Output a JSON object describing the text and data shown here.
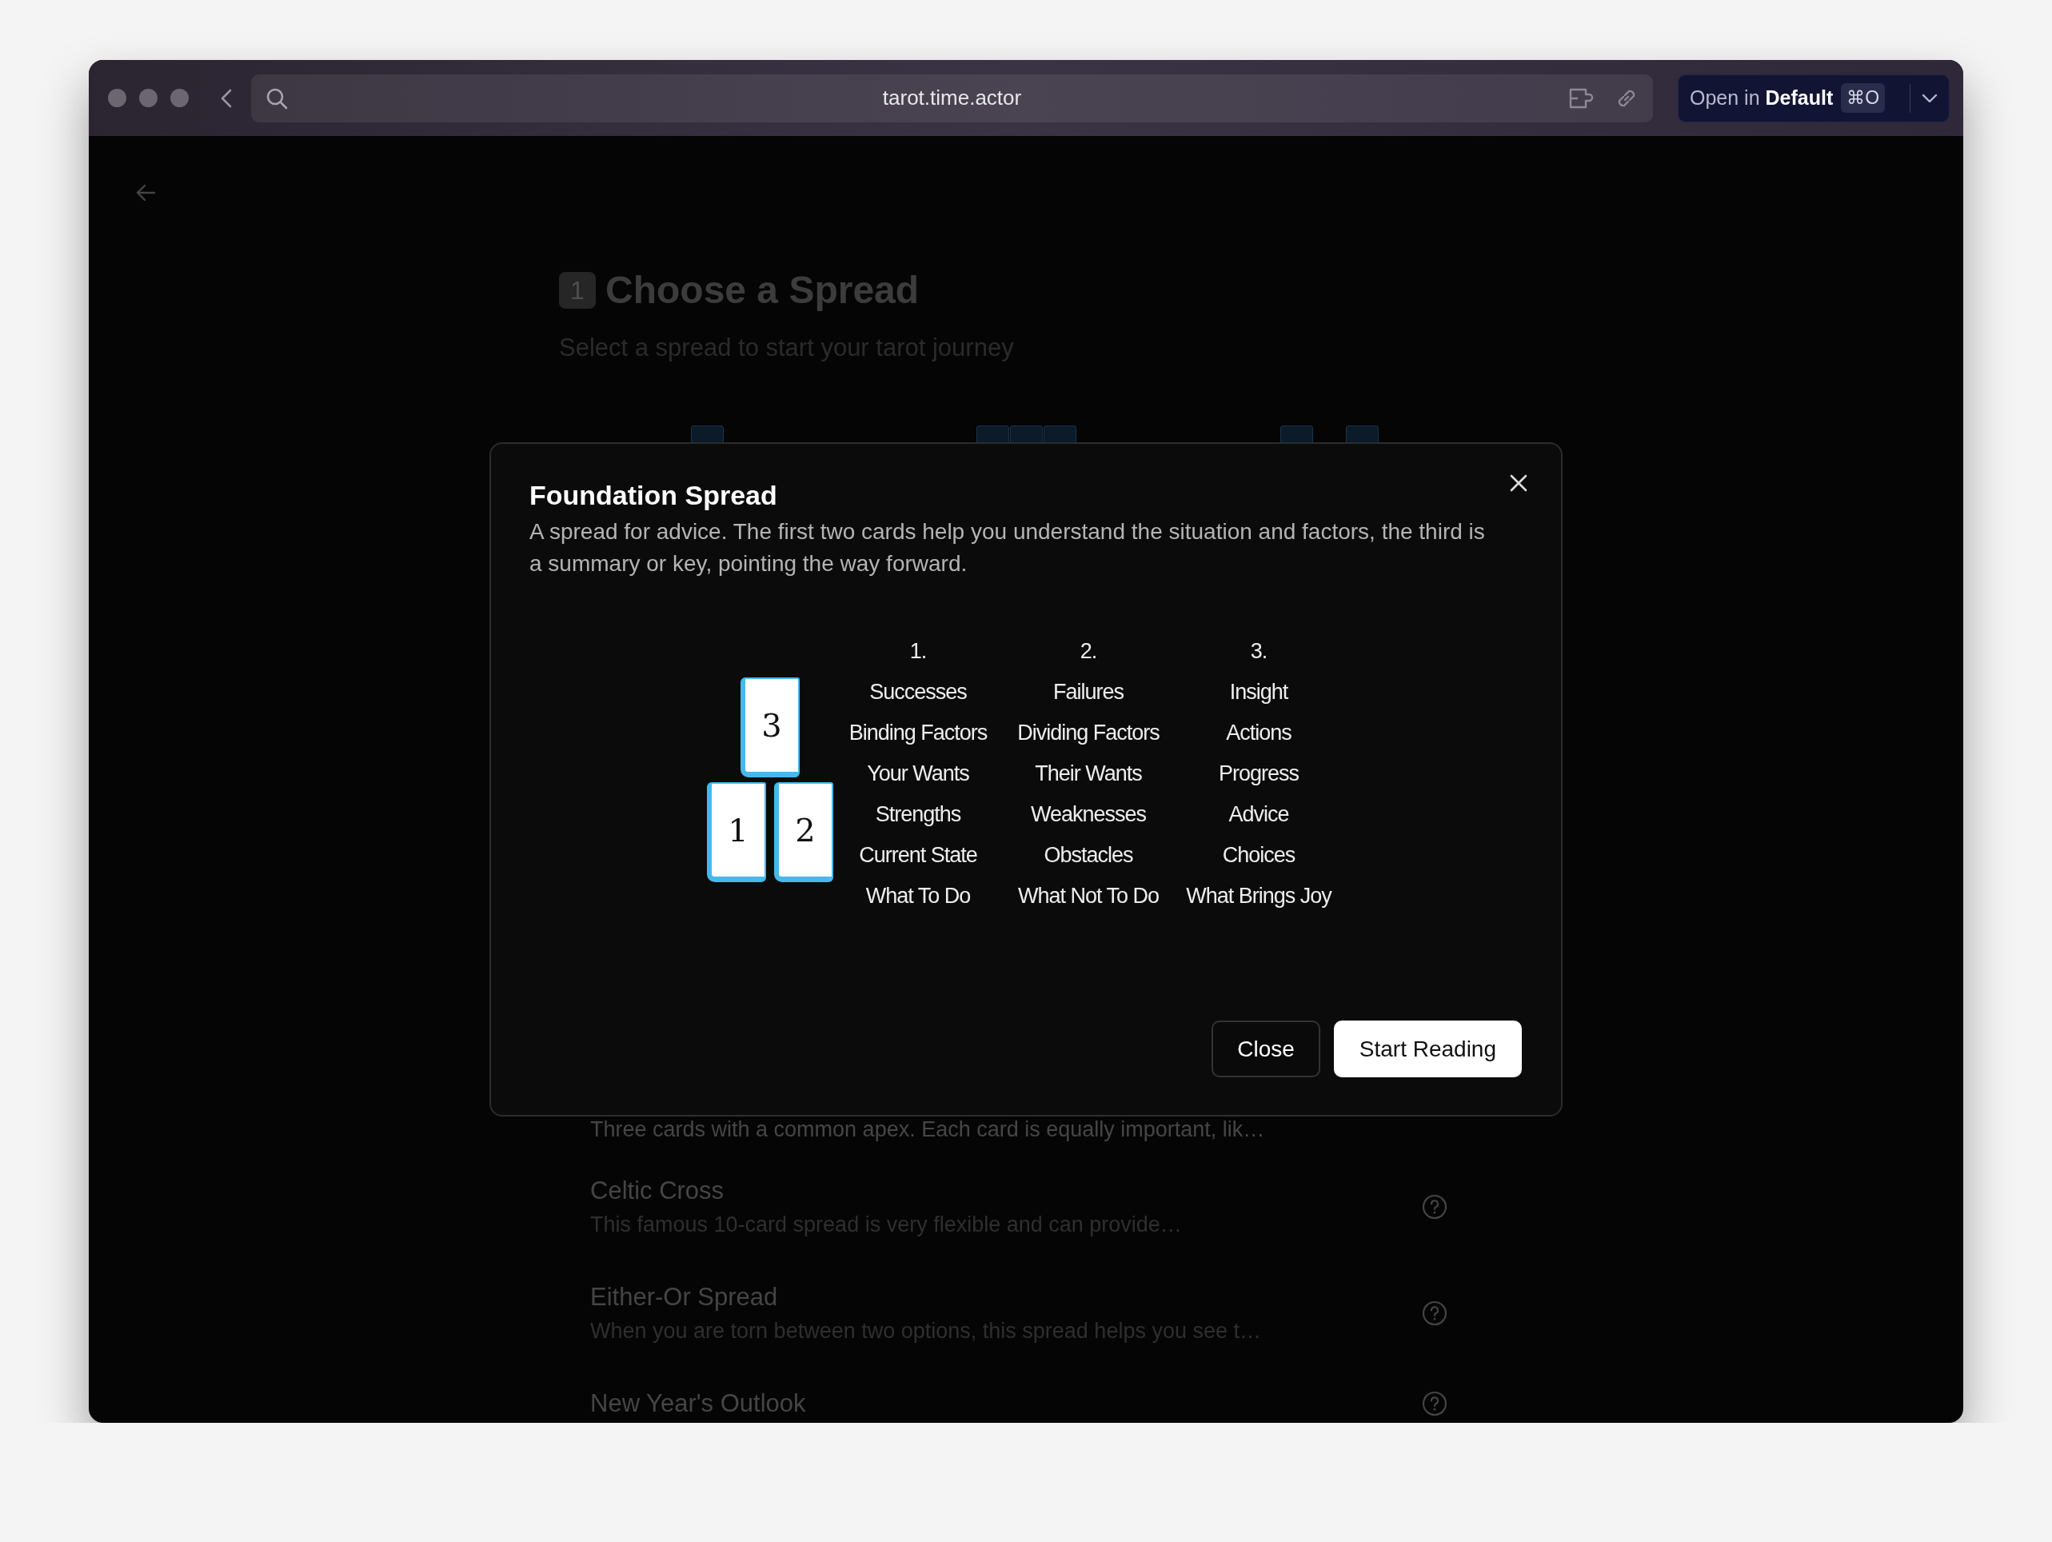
{
  "browser": {
    "url": "tarot.time.actor",
    "open_button": {
      "label": "Open in **Default**",
      "shortcut": "⌘O"
    }
  },
  "page": {
    "step": "1",
    "title": "Choose a Spread",
    "subtitle": "Select a spread to start your tarot journey",
    "spreads": [
      {
        "description": "Three cards with a common apex. Each card is equally important, lik…"
      },
      {
        "title": "Celtic Cross",
        "description": "This famous 10-card spread is very flexible and can provide…"
      },
      {
        "title": "Either-Or Spread",
        "description": "When you are torn between two options, this spread helps you see t…"
      },
      {
        "title": "New Year's Outlook"
      }
    ]
  },
  "modal": {
    "title": "Foundation Spread",
    "description": "A spread for advice. The first two cards help you understand the situation and factors, the third is a summary or key, pointing the way forward.",
    "cards": [
      "1",
      "2",
      "3"
    ],
    "columns": [
      {
        "header": "1.",
        "items": [
          "Successes",
          "Binding Factors",
          "Your Wants",
          "Strengths",
          "Current State",
          "What To Do"
        ]
      },
      {
        "header": "2.",
        "items": [
          "Failures",
          "Dividing Factors",
          "Their Wants",
          "Weaknesses",
          "Obstacles",
          "What Not To Do"
        ]
      },
      {
        "header": "3.",
        "items": [
          "Insight",
          "Actions",
          "Progress",
          "Advice",
          "Choices",
          "What Brings Joy"
        ]
      }
    ],
    "buttons": [
      {
        "label": "Close",
        "kind": "secondary"
      },
      {
        "label": "Start Reading",
        "kind": "primary"
      }
    ]
  }
}
